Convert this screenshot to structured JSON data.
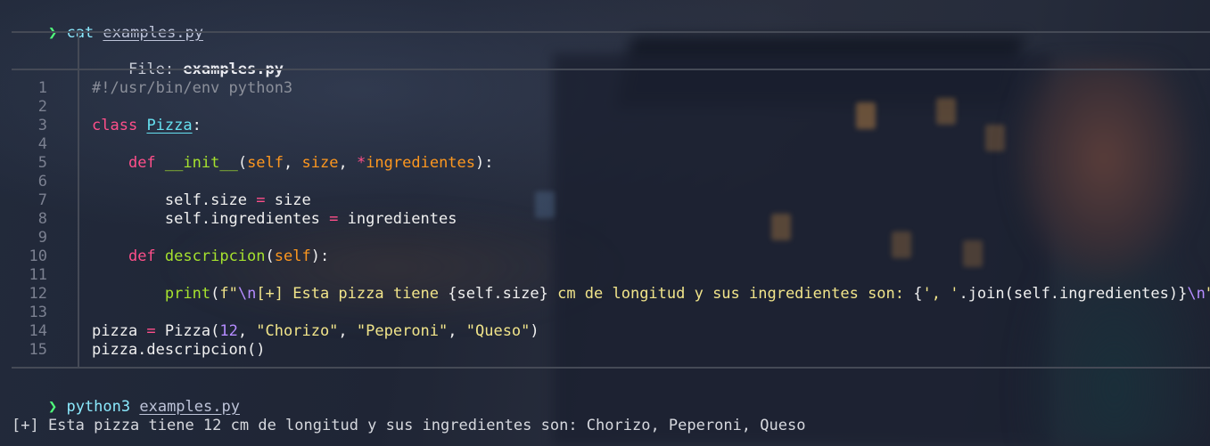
{
  "prompts": [
    {
      "symbol": "❯",
      "command": "cat",
      "argument": "examples.py"
    },
    {
      "symbol": "❯",
      "command": "python3",
      "argument": "examples.py"
    }
  ],
  "file_header": {
    "label": "File:",
    "filename": "examples.py"
  },
  "line_numbers": [
    "1",
    "2",
    "3",
    "4",
    "5",
    "6",
    "7",
    "8",
    "9",
    "10",
    "11",
    "12",
    "13",
    "14",
    "15"
  ],
  "code": {
    "l1": "#!/usr/bin/env python3",
    "l3": {
      "kw": "class",
      "name": "Pizza",
      "colon": ":"
    },
    "l5": {
      "indent": "    ",
      "kw": "def",
      "name": "__init__",
      "open": "(",
      "self": "self",
      "sep1": ", ",
      "size": "size",
      "sep2": ", ",
      "star": "*",
      "ingr": "ingredientes",
      "close": "):"
    },
    "l7": {
      "indent": "        ",
      "lhs": "self.size",
      "eq": " = ",
      "rhs": "size"
    },
    "l8": {
      "indent": "        ",
      "lhs": "self.ingredientes",
      "eq": " = ",
      "rhs": "ingredientes"
    },
    "l10": {
      "indent": "    ",
      "kw": "def",
      "name": "descripcion",
      "open": "(",
      "self": "self",
      "close": "):"
    },
    "l12": {
      "indent": "        ",
      "print": "print",
      "open": "(",
      "f": "f",
      "q1": "\"",
      "esc1": "\\n",
      "s1": "[+] Esta pizza tiene ",
      "e1": "{self.size}",
      "s2": " cm de longitud y sus ingredientes son: ",
      "e2a": "{",
      "s3": "', '",
      "e2b": ".join(self.ingredientes)}",
      "esc2": "\\n",
      "q2": "\"",
      "close": ")"
    },
    "l14": {
      "lhs": "pizza",
      "eq": " = ",
      "call": "Pizza(",
      "num": "12",
      "c1": ", ",
      "a1": "\"Chorizo\"",
      "c2": ", ",
      "a2": "\"Peperoni\"",
      "c3": ", ",
      "a3": "\"Queso\"",
      "close": ")"
    },
    "l15": "pizza.descripcion()"
  },
  "output": "[+] Esta pizza tiene 12 cm de longitud y sus ingredientes son: Chorizo, Peperoni, Queso",
  "colors": {
    "prompt_arrow": "#50fa7b",
    "keyword": "#ff4f8a",
    "function": "#a6e22e",
    "param": "#fd971f",
    "string": "#f1e48a",
    "number": "#b58cff"
  }
}
